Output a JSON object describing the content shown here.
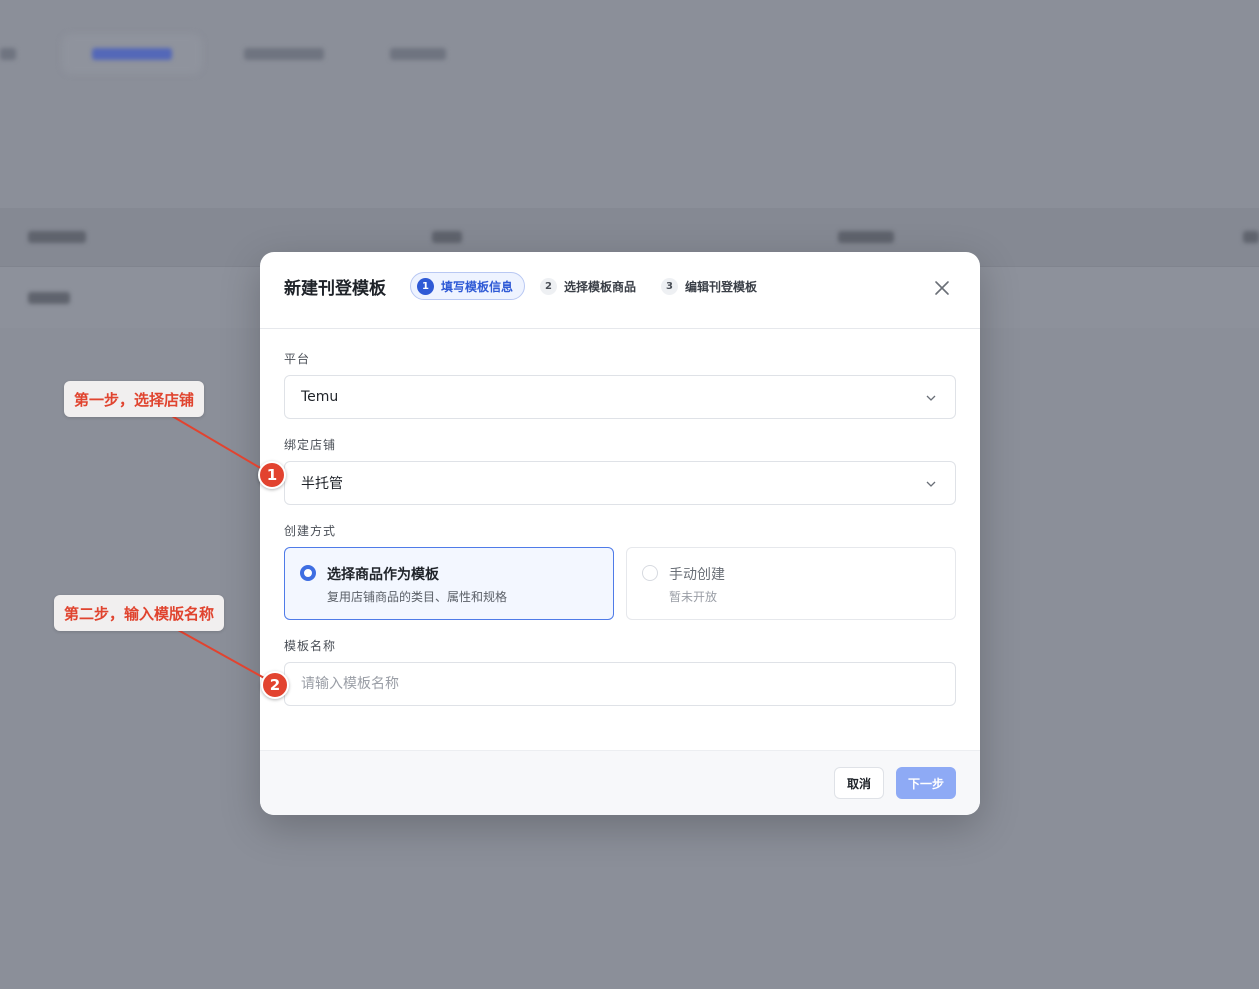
{
  "modal": {
    "title": "新建刊登模板",
    "steps": [
      {
        "num": "1",
        "label": "填写模板信息"
      },
      {
        "num": "2",
        "label": "选择模板商品"
      },
      {
        "num": "3",
        "label": "编辑刊登模板"
      }
    ],
    "platform": {
      "label": "平台",
      "value": "Temu"
    },
    "shop": {
      "label": "绑定店铺",
      "value": "半托管"
    },
    "creation": {
      "label": "创建方式",
      "options": [
        {
          "title": "选择商品作为模板",
          "desc": "复用店铺商品的类目、属性和规格"
        },
        {
          "title": "手动创建",
          "desc": "暂未开放"
        }
      ]
    },
    "template_name": {
      "label": "模板名称",
      "placeholder": "请输入模板名称"
    },
    "footer": {
      "cancel_label": "取消",
      "next_label": "下一步"
    }
  },
  "annotations": [
    {
      "text": "第一步，选择店铺",
      "marker": "1"
    },
    {
      "text": "第二步，输入模版名称",
      "marker": "2"
    }
  ],
  "colors": {
    "accent": "#2f5ad6",
    "annotation": "#e2432f",
    "overlay": "#8b8f99"
  }
}
